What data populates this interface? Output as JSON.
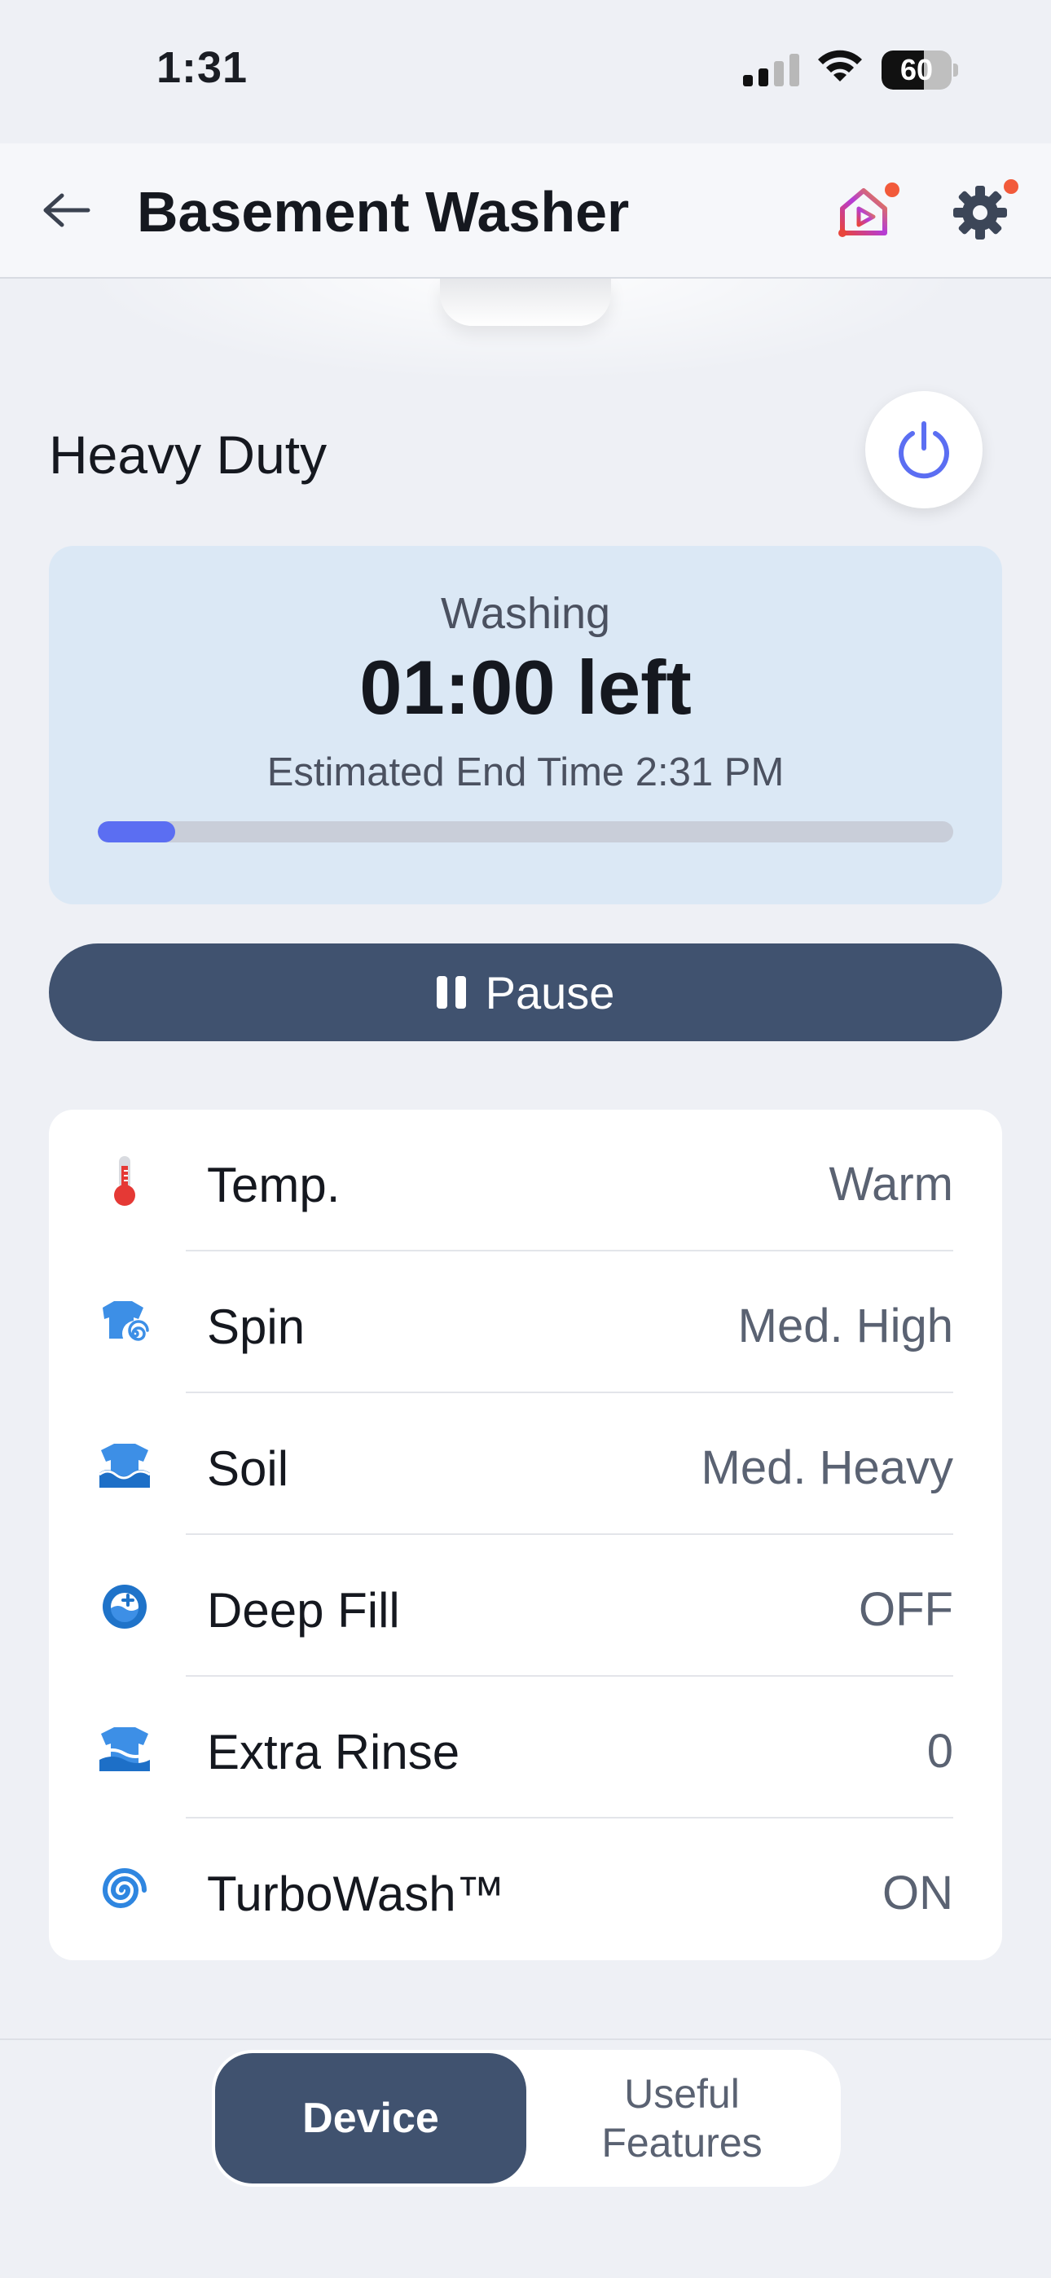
{
  "status_bar": {
    "time": "1:31",
    "battery": "60",
    "battery_level": 0.6
  },
  "header": {
    "title": "Basement Washer"
  },
  "cycle": {
    "name": "Heavy Duty"
  },
  "status": {
    "state": "Washing",
    "time_left": "01:00 left",
    "end_time": "Estimated End Time 2:31 PM",
    "progress": 0.09
  },
  "controls": {
    "pause_label": "Pause"
  },
  "settings": [
    {
      "label": "Temp.",
      "value": "Warm",
      "icon": "thermometer-icon"
    },
    {
      "label": "Spin",
      "value": "Med. High",
      "icon": "spin-icon"
    },
    {
      "label": "Soil",
      "value": "Med. Heavy",
      "icon": "soil-icon"
    },
    {
      "label": "Deep Fill",
      "value": "OFF",
      "icon": "deep-fill-icon"
    },
    {
      "label": "Extra Rinse",
      "value": "0",
      "icon": "extra-rinse-icon"
    },
    {
      "label": "TurboWash™",
      "value": "ON",
      "icon": "turbowash-icon"
    }
  ],
  "tabs": {
    "device": "Device",
    "useful_features": "Useful Features"
  },
  "colors": {
    "accent": "#5b6ef2",
    "button": "#40526f",
    "status_card": "#dbe8f5",
    "notification": "#f25a3a"
  }
}
